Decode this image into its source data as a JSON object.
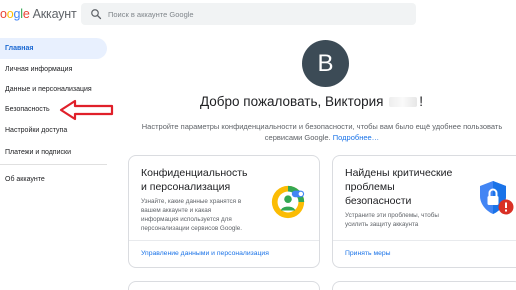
{
  "header": {
    "logo_letters": [
      "o",
      "o",
      "g",
      "l",
      "e"
    ],
    "logo_prefix": "G",
    "product": "Аккаунт",
    "search_placeholder": "Поиск в аккаунте Google"
  },
  "sidebar": {
    "items": [
      {
        "label": "Главная",
        "active": true
      },
      {
        "label": "Личная информация"
      },
      {
        "label": "Данные и персонализация"
      },
      {
        "label": "Безопасность"
      },
      {
        "label": "Настройки доступа"
      },
      {
        "label": "Платежи и подписки"
      },
      {
        "label": "Об аккаунте"
      }
    ]
  },
  "main": {
    "avatar_letter": "В",
    "welcome_prefix": "Добро пожаловать, Виктория",
    "welcome_suffix": "!",
    "subtitle_line1": "Настройте параметры конфиденциальности и безопасности, чтобы вам было ещё удобнее пользовать",
    "subtitle_line2": "сервисами Google.",
    "subtitle_more": "Подробнее…",
    "cards": [
      {
        "title_line1": "Конфиденциальность",
        "title_line2": "и персонализация",
        "desc": [
          "Узнайте, какие данные хранятся в",
          "вашем аккаунте и какая",
          "информация используется для",
          "персонализации сервисов Google."
        ],
        "link": "Управление данными и персонализация"
      },
      {
        "title_line1": "Найдены критические",
        "title_line2": "проблемы",
        "title_line3": "безопасности",
        "desc": [
          "Устраните эти проблемы, чтобы",
          "усилить защиту аккаунта"
        ],
        "link": "Принять меры"
      }
    ]
  },
  "colors": {
    "accent": "#1a73e8",
    "active_bg": "#e8f0fe",
    "arrow": "#e0202a",
    "avatar": "#3c4b56"
  }
}
